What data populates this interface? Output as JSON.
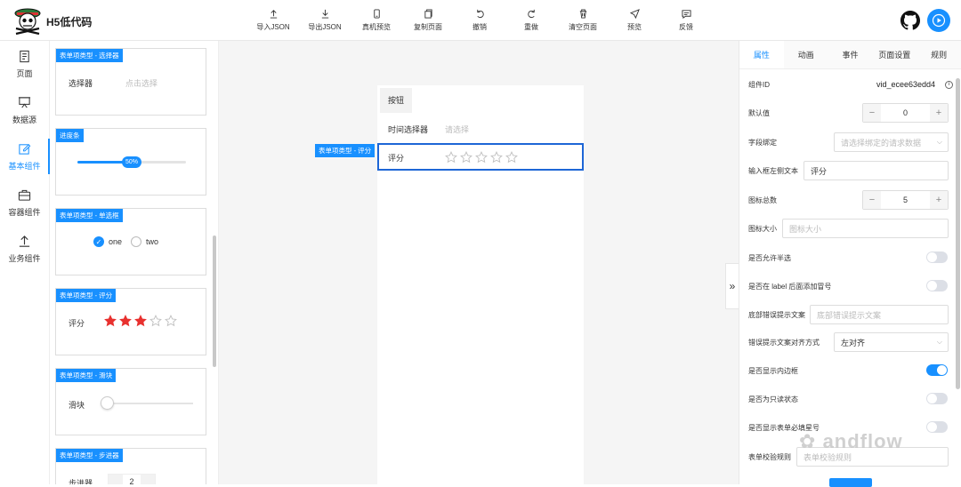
{
  "app": {
    "brand": "H5低代码"
  },
  "toolbar": [
    {
      "label": "导入JSON",
      "icon": "upload-icon"
    },
    {
      "label": "导出JSON",
      "icon": "download-icon"
    },
    {
      "label": "真机预览",
      "icon": "phone-icon"
    },
    {
      "label": "复制页面",
      "icon": "copy-icon"
    },
    {
      "label": "撤销",
      "icon": "undo-icon"
    },
    {
      "label": "重做",
      "icon": "redo-icon"
    },
    {
      "label": "清空页面",
      "icon": "trash-icon"
    },
    {
      "label": "预览",
      "icon": "send-icon"
    },
    {
      "label": "反馈",
      "icon": "message-icon"
    }
  ],
  "nav": [
    {
      "label": "页面",
      "icon": "page-icon",
      "active": false
    },
    {
      "label": "数据源",
      "icon": "datasource-icon",
      "active": false
    },
    {
      "label": "基本组件",
      "icon": "edit-icon",
      "active": true
    },
    {
      "label": "容器组件",
      "icon": "briefcase-icon",
      "active": false
    },
    {
      "label": "业务组件",
      "icon": "upload-icon",
      "active": false
    }
  ],
  "library": {
    "select": {
      "tag": "表单项类型 - 选择器",
      "label": "选择器",
      "placeholder": "点击选择"
    },
    "progress": {
      "tag": "进度条",
      "value": "50%",
      "percent": 50
    },
    "radio": {
      "tag": "表单项类型 - 单选框",
      "options": [
        "one",
        "two"
      ],
      "checked": 0
    },
    "rate": {
      "tag": "表单项类型 - 评分",
      "label": "评分",
      "value": 3,
      "count": 5
    },
    "slider": {
      "tag": "表单项类型 - 滑块",
      "label": "滑块"
    },
    "stepper": {
      "tag": "表单项类型 - 步进器",
      "label": "步进器",
      "value": "2"
    }
  },
  "canvas": {
    "button_label": "按钮",
    "time_label": "时间选择器",
    "time_placeholder": "请选择",
    "rate_label": "评分",
    "rate_count": 5,
    "selected_tag": "表单项类型 - 评分"
  },
  "panel": {
    "tabs": [
      "属性",
      "动画",
      "事件",
      "页面设置",
      "规则"
    ],
    "active_tab": 0,
    "component_id_label": "组件ID",
    "component_id": "vid_ecee63edd4",
    "default_label": "默认值",
    "default_value": "0",
    "field_label": "字段绑定",
    "field_placeholder": "请选择绑定的请求数据",
    "input_left_label": "输入框左侧文本",
    "input_left_value": "评分",
    "icon_total_label": "图标总数",
    "icon_total_value": "5",
    "icon_size_label": "图标大小",
    "icon_size_placeholder": "图标大小",
    "half_label": "是否允许半选",
    "half_on": false,
    "colon_label": "是否在 label 后面添加冒号",
    "colon_on": false,
    "error_text_label": "底部错误提示文案",
    "error_text_placeholder": "底部错误提示文案",
    "error_align_label": "错误提示文案对齐方式",
    "error_align_value": "左对齐",
    "border_label": "是否显示内边框",
    "border_on": true,
    "readonly_label": "是否为只读状态",
    "readonly_on": false,
    "required_label": "是否显示表单必填星号",
    "required_on": false,
    "rules_label": "表单校验规则",
    "rules_placeholder": "表单校验规则"
  },
  "watermark": "andflow",
  "colors": {
    "accent": "#1890ff",
    "star": "#e8312f"
  }
}
